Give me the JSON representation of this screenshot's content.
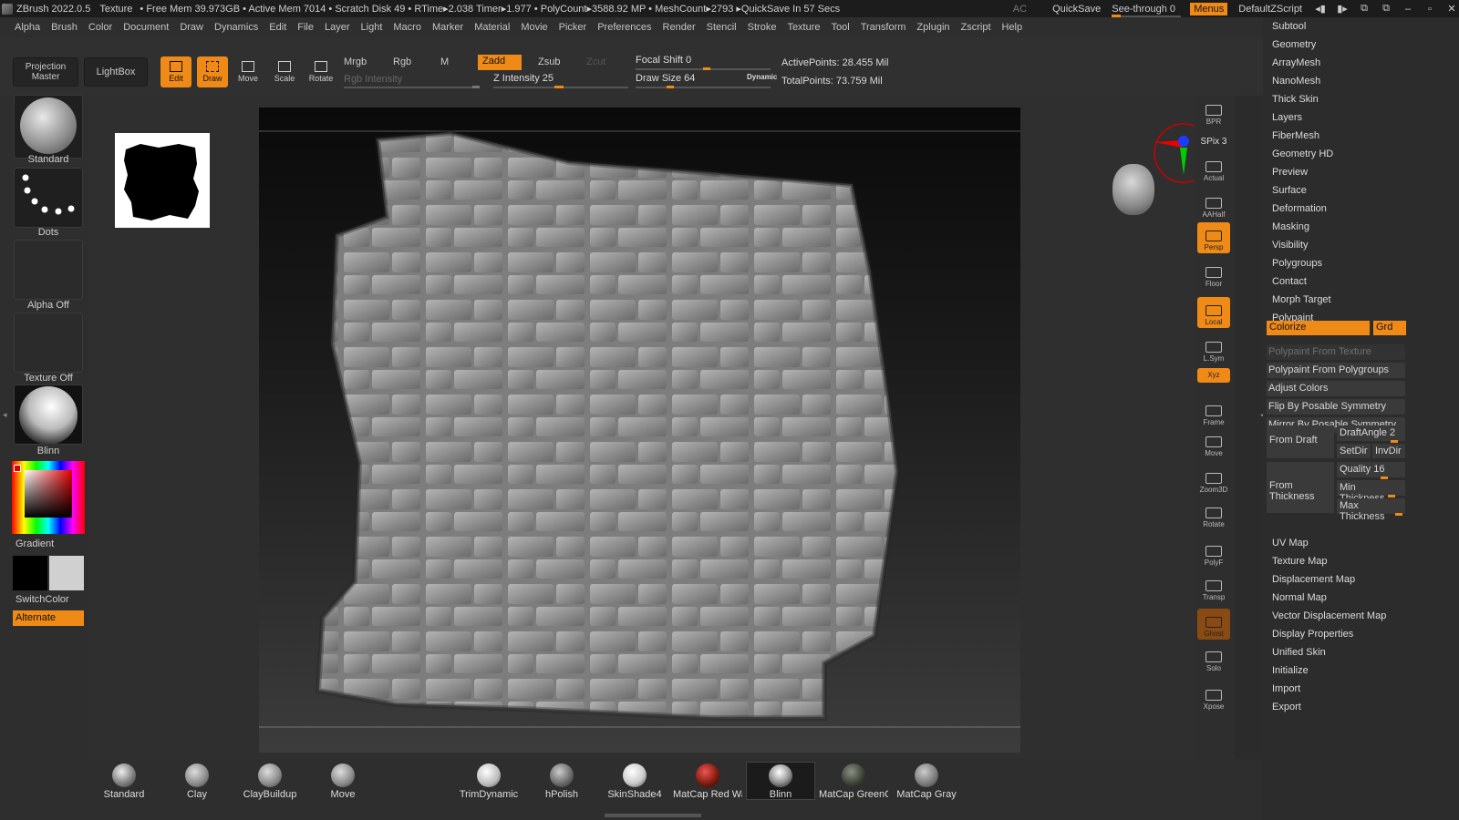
{
  "title": {
    "app": "ZBrush 2022.0.5",
    "doc": "Texture",
    "stats": "• Free Mem 39.973GB • Active Mem 7014 • Scratch Disk 49 • RTime▸2.038 Timer▸1.977 • PolyCount▸3588.92 MP • MeshCount▸2793 ▸QuickSave In 57 Secs",
    "ac": "AC",
    "quicksave": "QuickSave",
    "see_through": "See-through",
    "see_through_val": "0",
    "menus": "Menus",
    "zscript": "DefaultZScript"
  },
  "menus": [
    "Alpha",
    "Brush",
    "Color",
    "Document",
    "Draw",
    "Dynamics",
    "Edit",
    "File",
    "Layer",
    "Light",
    "Macro",
    "Marker",
    "Material",
    "Movie",
    "Picker",
    "Preferences",
    "Render",
    "Stencil",
    "Stroke",
    "Texture",
    "Tool",
    "Transform",
    "Zplugin",
    "Zscript",
    "Help"
  ],
  "toolbar": {
    "projection_master": "Projection Master",
    "lightbox": "LightBox",
    "edit": "Edit",
    "draw": "Draw",
    "move": "Move",
    "scale": "Scale",
    "rotate": "Rotate",
    "mrgb": "Mrgb",
    "rgb": "Rgb",
    "m": "M",
    "rgb_intensity": "Rgb Intensity",
    "zadd": "Zadd",
    "zsub": "Zsub",
    "zcut": "Zcut",
    "z_intensity": "Z Intensity 25",
    "focal_shift": "Focal Shift 0",
    "draw_size": "Draw Size 64",
    "dynamic": "Dynamic",
    "active_points": "ActivePoints: 28.455 Mil",
    "total_points": "TotalPoints: 73.759 Mil"
  },
  "left_shelf": {
    "brush": "Standard",
    "stroke": "Dots",
    "alpha": "Alpha Off",
    "texture": "Texture Off",
    "material": "Blinn",
    "gradient": "Gradient",
    "switch_color": "SwitchColor",
    "alternate": "Alternate"
  },
  "right_dock": [
    {
      "name": "bpr",
      "label": "BPR"
    },
    {
      "name": "spix",
      "label": "SPix 3"
    },
    {
      "name": "actual",
      "label": "Actual"
    },
    {
      "name": "aahalf",
      "label": "AAHalf"
    },
    {
      "name": "persp",
      "label": "Persp"
    },
    {
      "name": "floor",
      "label": "Floor"
    },
    {
      "name": "local",
      "label": "Local"
    },
    {
      "name": "lsym",
      "label": "L.Sym"
    },
    {
      "name": "xyz",
      "label": "Xyz"
    },
    {
      "name": "frame",
      "label": "Frame"
    },
    {
      "name": "move",
      "label": "Move"
    },
    {
      "name": "zoom3d",
      "label": "Zoom3D"
    },
    {
      "name": "rotate",
      "label": "Rotate"
    },
    {
      "name": "polyf",
      "label": "PolyF"
    },
    {
      "name": "transp",
      "label": "Transp"
    },
    {
      "name": "ghost",
      "label": "Ghost"
    },
    {
      "name": "solo",
      "label": "Solo"
    },
    {
      "name": "xpose",
      "label": "Xpose"
    }
  ],
  "right_panel": {
    "items_top": [
      "Subtool",
      "Geometry",
      "ArrayMesh",
      "NanoMesh",
      "Thick Skin",
      "Layers",
      "FiberMesh",
      "Geometry HD",
      "Preview",
      "Surface",
      "Deformation",
      "Masking",
      "Visibility",
      "Polygroups",
      "Contact",
      "Morph Target",
      "Polypaint"
    ],
    "colorize": "Colorize",
    "grd": "Grd",
    "polypaint_buttons": [
      "Polypaint From Texture",
      "Polypaint From Polygroups",
      "Adjust Colors",
      "Flip By Posable Symmetry",
      "Mirror By Posable Symmetry"
    ],
    "from_draft": "From Draft",
    "draft_angle": "DraftAngle 2",
    "setdir": "SetDir",
    "invdir": "InvDir",
    "from_thickness": "From Thickness",
    "quality": "Quality 16",
    "min_thickness": "Min Thickness",
    "max_thickness": "Max Thickness",
    "items_bottom": [
      "UV Map",
      "Texture Map",
      "Displacement Map",
      "Normal Map",
      "Vector Displacement Map",
      "Display Properties",
      "Unified Skin",
      "Initialize",
      "Import",
      "Export"
    ]
  },
  "materials": [
    "Standard",
    "Clay",
    "ClayBuildup",
    "Move",
    "TrimDynamic",
    "hPolish",
    "SkinShade4",
    "MatCap Red Wax",
    "Blinn",
    "MatCap GreenCl",
    "MatCap Gray"
  ],
  "colors": {
    "accent": "#f08a17",
    "bg": "#2b2b2b"
  }
}
